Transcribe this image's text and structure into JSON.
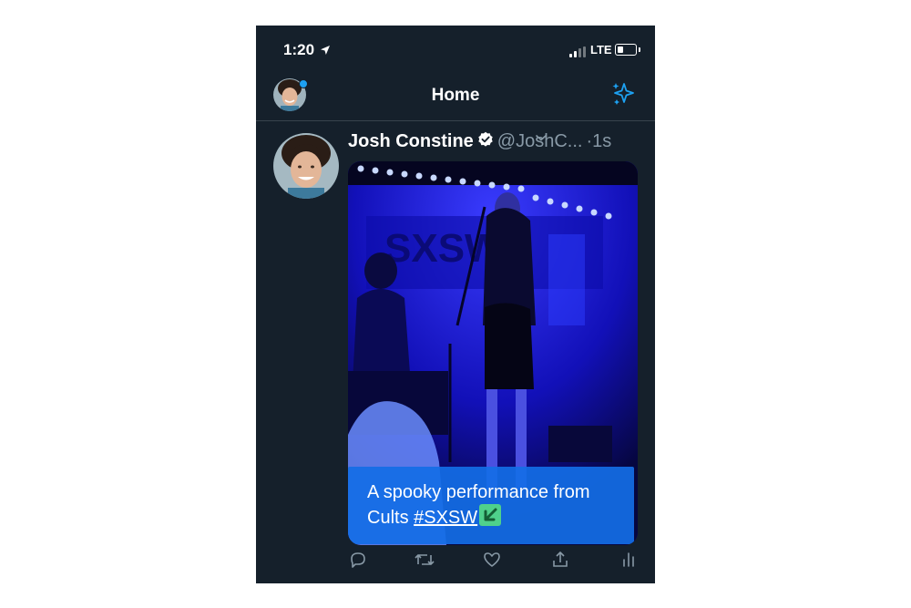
{
  "status_bar": {
    "time": "1:20",
    "network": "LTE"
  },
  "nav": {
    "title": "Home"
  },
  "tweet": {
    "author_name": "Josh Constine",
    "handle": "@JoshC...",
    "separator": "·",
    "time_ago": "1s",
    "caption_prefix": "A spooky performance from Cults ",
    "hashtag": "#SXSW",
    "media_signage": "SXSW"
  },
  "icons": {
    "location": "location-arrow-icon",
    "signal": "cellular-signal-icon",
    "battery": "battery-icon",
    "sparkle": "sparkle-icon",
    "verified": "verified-badge-icon",
    "chevron": "chevron-down-icon",
    "reply": "reply-icon",
    "retweet": "retweet-icon",
    "like": "heart-icon",
    "share": "share-icon",
    "analytics": "analytics-icon",
    "arrow_emoji": "down-left-arrow-emoji"
  },
  "colors": {
    "background": "#15202b",
    "accent": "#1da1f2",
    "secondary_text": "#8899a6",
    "divider": "#38444d"
  }
}
